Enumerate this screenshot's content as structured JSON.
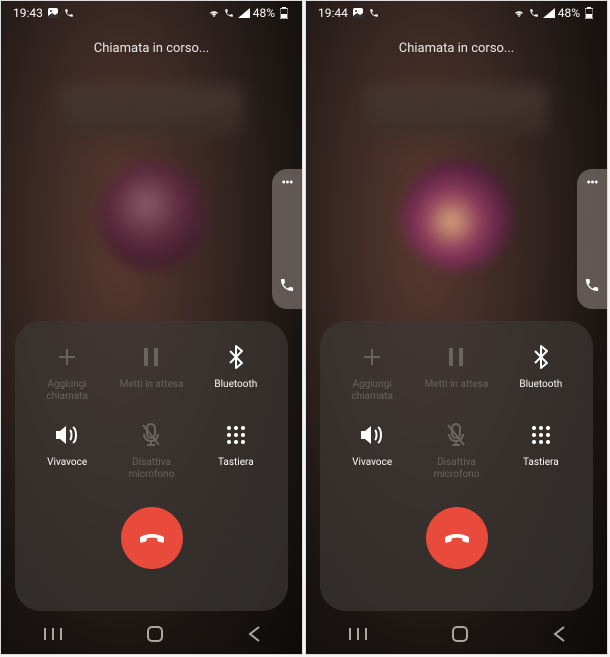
{
  "screens": [
    {
      "status": {
        "time": "19:43",
        "battery": "48%"
      },
      "call_status": "Chiamata in corso...",
      "controls": {
        "add_call": "Aggiungi\nchiamata",
        "hold": "Metti in attesa",
        "bluetooth": "Bluetooth",
        "speaker": "Vivavoce",
        "mute": "Disattiva\nmicrofono",
        "keypad": "Tastiera"
      }
    },
    {
      "status": {
        "time": "19:44",
        "battery": "48%"
      },
      "call_status": "Chiamata in corso...",
      "controls": {
        "add_call": "Aggiungi\nchiamata",
        "hold": "Metti in attesa",
        "bluetooth": "Bluetooth",
        "speaker": "Vivavoce",
        "mute": "Disattiva\nmicrofono",
        "keypad": "Tastiera"
      }
    }
  ]
}
